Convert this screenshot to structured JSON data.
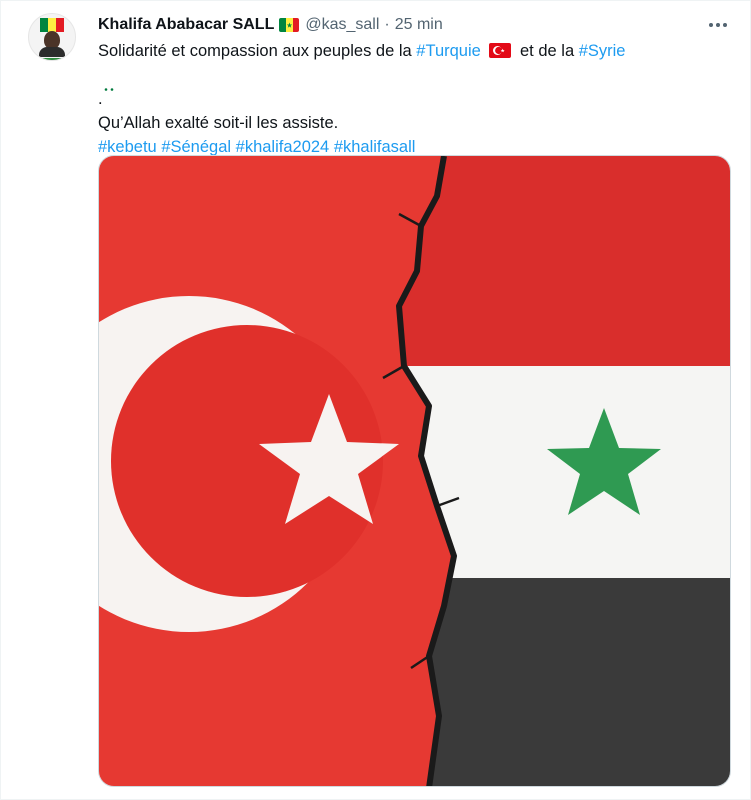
{
  "tweet": {
    "author_name": "Khalifa Ababacar SALL",
    "handle": "@kas_sall",
    "separator": "·",
    "time": "25 min",
    "line1_before": "Solidarité et compassion aux peuples de la",
    "hashtag_turquie": "#Turquie",
    "line1_middle": "et de la",
    "hashtag_syrie": "#Syrie",
    "line1_end": ".",
    "line2": "Qu’Allah exalté soit-il les assiste.",
    "hashtags": [
      "#kebetu",
      "#Sénégal",
      "#khalifa2024",
      "#khalifasall"
    ]
  },
  "icons": {
    "author_flag": "senegal-flag-icon",
    "more": "more-options-icon",
    "turkey_flag": "turkey-flag-icon",
    "syria_flag": "syria-flag-icon"
  },
  "colors": {
    "link": "#1d9bf0",
    "text": "#0f1419",
    "secondary": "#536471",
    "turkey_red": "#e30a17",
    "syria_green": "#2f9a52"
  }
}
